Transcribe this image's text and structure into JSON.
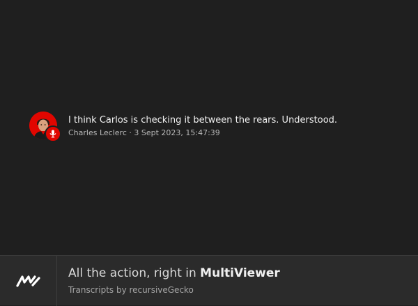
{
  "message": {
    "text": "I think Carlos is checking it between the rears. Understood.",
    "meta": "Charles Leclerc · 3 Sept 2023, 15:47:39",
    "avatar_icon": "driver-avatar-icon",
    "badge_icon": "microphone-icon"
  },
  "footer": {
    "tagline_prefix": "All the action, right in ",
    "tagline_brand": "MultiViewer",
    "credit": "Transcripts by recursiveGecko",
    "logo_icon": "multiviewer-logo-icon"
  },
  "colors": {
    "background": "#1f1f1f",
    "footer_background": "#2b2b2b",
    "accent_red": "#e10600"
  }
}
